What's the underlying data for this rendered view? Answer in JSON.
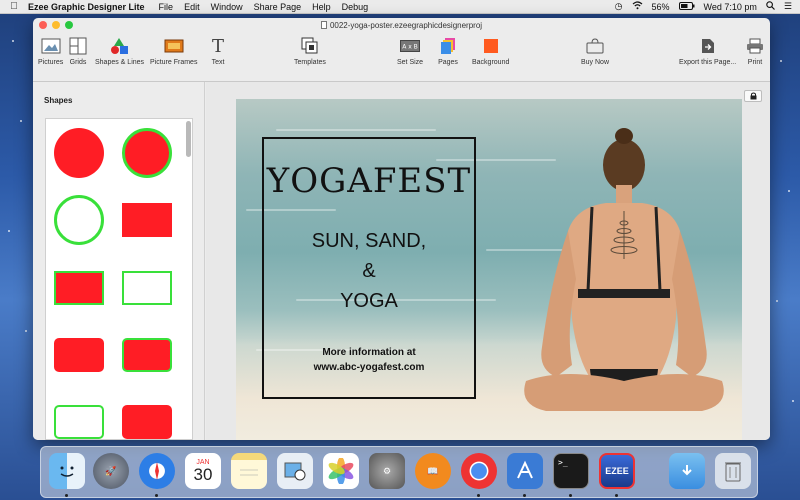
{
  "menubar": {
    "app_name": "Ezee Graphic Designer Lite",
    "menus": [
      "File",
      "Edit",
      "Window",
      "Share Page",
      "Help",
      "Debug"
    ],
    "battery": "56%",
    "clock": "Wed 7:10 pm"
  },
  "window": {
    "title": "0022-yoga-poster.ezeegraphicdesignerproj"
  },
  "toolbar": {
    "pictures": "Pictures",
    "grids": "Grids",
    "shapes_lines": "Shapes & Lines",
    "picture_frames": "Picture Frames",
    "text": "Text",
    "templates": "Templates",
    "set_size": "Set Size",
    "pages": "Pages",
    "background": "Background",
    "buy_now": "Buy Now",
    "export": "Export this Page...",
    "print": "Print"
  },
  "sidebar": {
    "title": "Shapes"
  },
  "poster": {
    "title": "YOGAFEST",
    "line1": "SUN, SAND,",
    "line2": "&",
    "line3": "YOGA",
    "info1": "More information at",
    "info2": "www.abc-yogafest.com"
  },
  "colors": {
    "shape_red": "#ff1d25",
    "shape_green": "#39e03a",
    "background_swatch": "#ff5a1f"
  },
  "dock": {
    "calendar_month": "JAN",
    "calendar_day": "30",
    "ezee_label": "EZEE",
    "items": [
      "finder",
      "launchpad",
      "safari",
      "calendar",
      "notes",
      "preview",
      "photos",
      "system-preferences",
      "ibooks",
      "chrome",
      "xcode",
      "terminal",
      "ezee-graphic-designer",
      "downloads",
      "trash"
    ]
  }
}
